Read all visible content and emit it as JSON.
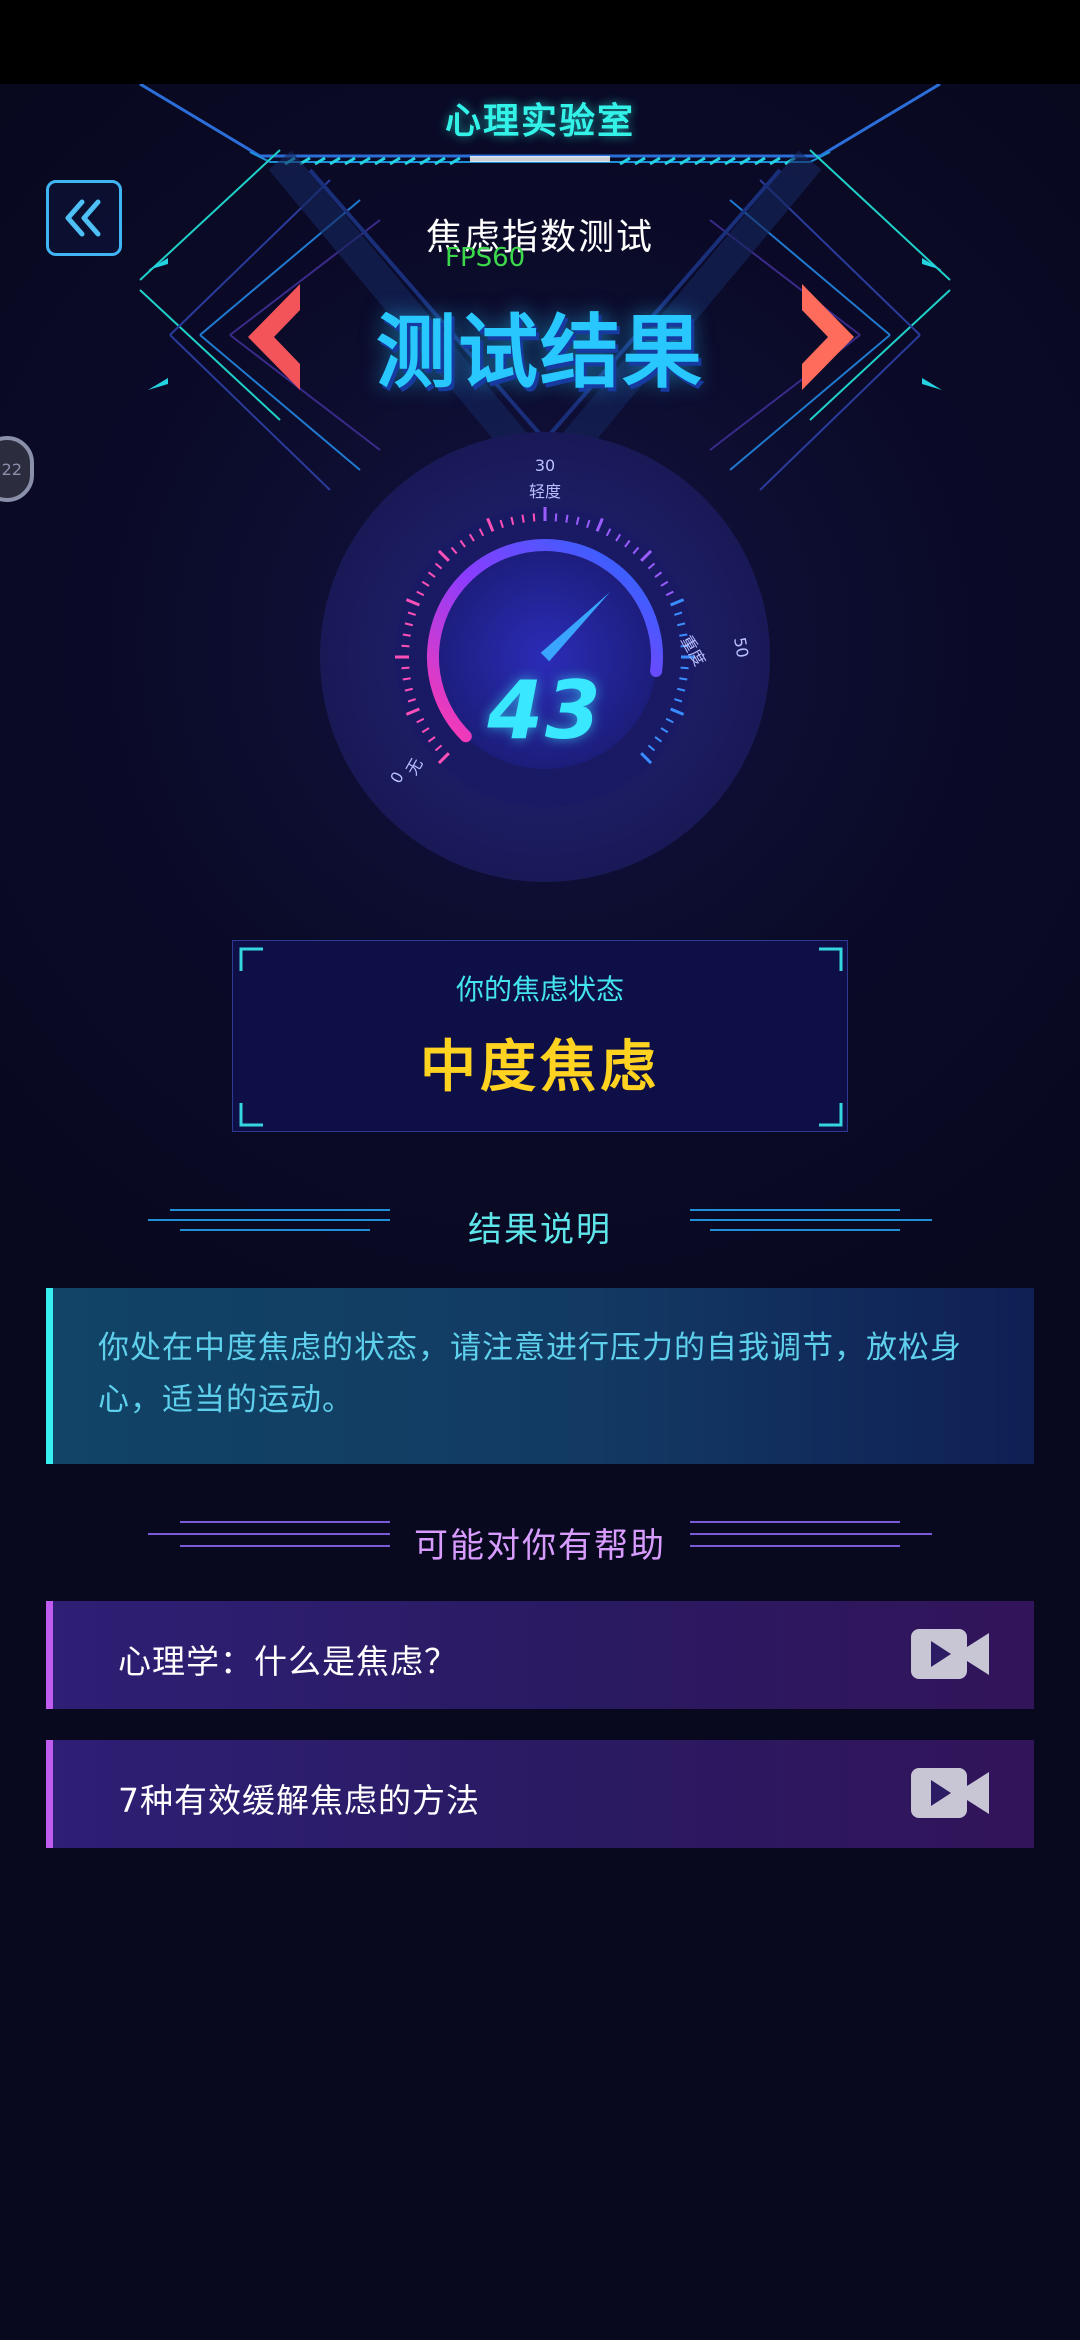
{
  "header": {
    "title": "心理实验室"
  },
  "side_float": {
    "label": "22"
  },
  "test": {
    "name": "焦虑指数测试",
    "fps": "FPS60",
    "result_title": "测试结果"
  },
  "gauge": {
    "score": "43",
    "tick_top": "30",
    "level_light": "轻度",
    "level_severe": "重度",
    "tick_right": "50",
    "level_none": "无",
    "tick_left": "0",
    "fill_fraction": 0.86
  },
  "status_card": {
    "label": "你的焦虑状态",
    "value": "中度焦虑"
  },
  "result_section": {
    "title": "结果说明",
    "text": "你处在中度焦虑的状态，请注意进行压力的自我调节，放松身心，适当的运动。"
  },
  "help_section": {
    "title": "可能对你有帮助",
    "items": [
      {
        "label": "心理学：什么是焦虑？",
        "icon": "video-camera-icon"
      },
      {
        "label": "7种有效缓解焦虑的方法",
        "icon": "video-camera-icon"
      }
    ]
  },
  "colors": {
    "background": "#08081f",
    "accent_cyan": "#33f3e8",
    "result_blue": "#28c8ff",
    "status_yellow": "#ffd320",
    "help_purple": "#c05cf0"
  }
}
